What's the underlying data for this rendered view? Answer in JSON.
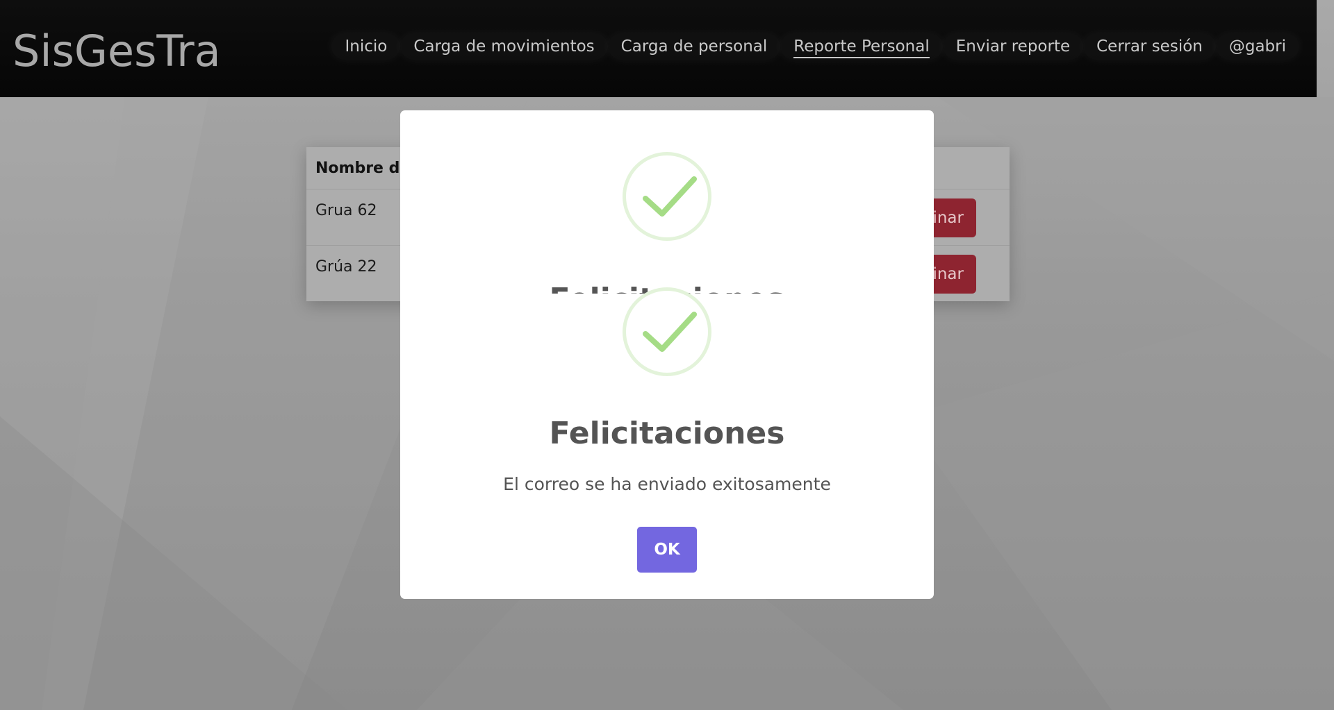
{
  "navbar": {
    "brand": "SisGesTra",
    "items": [
      {
        "label": "Inicio",
        "active": false
      },
      {
        "label": "Carga de movimientos",
        "active": false
      },
      {
        "label": "Carga de personal",
        "active": false
      },
      {
        "label": "Reporte Personal",
        "active": true
      },
      {
        "label": "Enviar reporte",
        "active": false
      },
      {
        "label": "Cerrar sesión",
        "active": false
      },
      {
        "label": "@gabri",
        "active": false
      }
    ]
  },
  "table": {
    "header": "Nombre de",
    "rows": [
      {
        "name": "Grua 62",
        "action": "inar"
      },
      {
        "name": "Grúa 22",
        "action": "inar"
      }
    ]
  },
  "modal": {
    "ghost_title": "Felicitaciones",
    "title": "Felicitaciones",
    "text": "El correo se ha enviado exitosamente",
    "ok_label": "OK",
    "icon": "success-check-icon"
  },
  "colors": {
    "confirm": "#7367e0",
    "success": "#a5dc86",
    "danger": "#dc3545"
  }
}
